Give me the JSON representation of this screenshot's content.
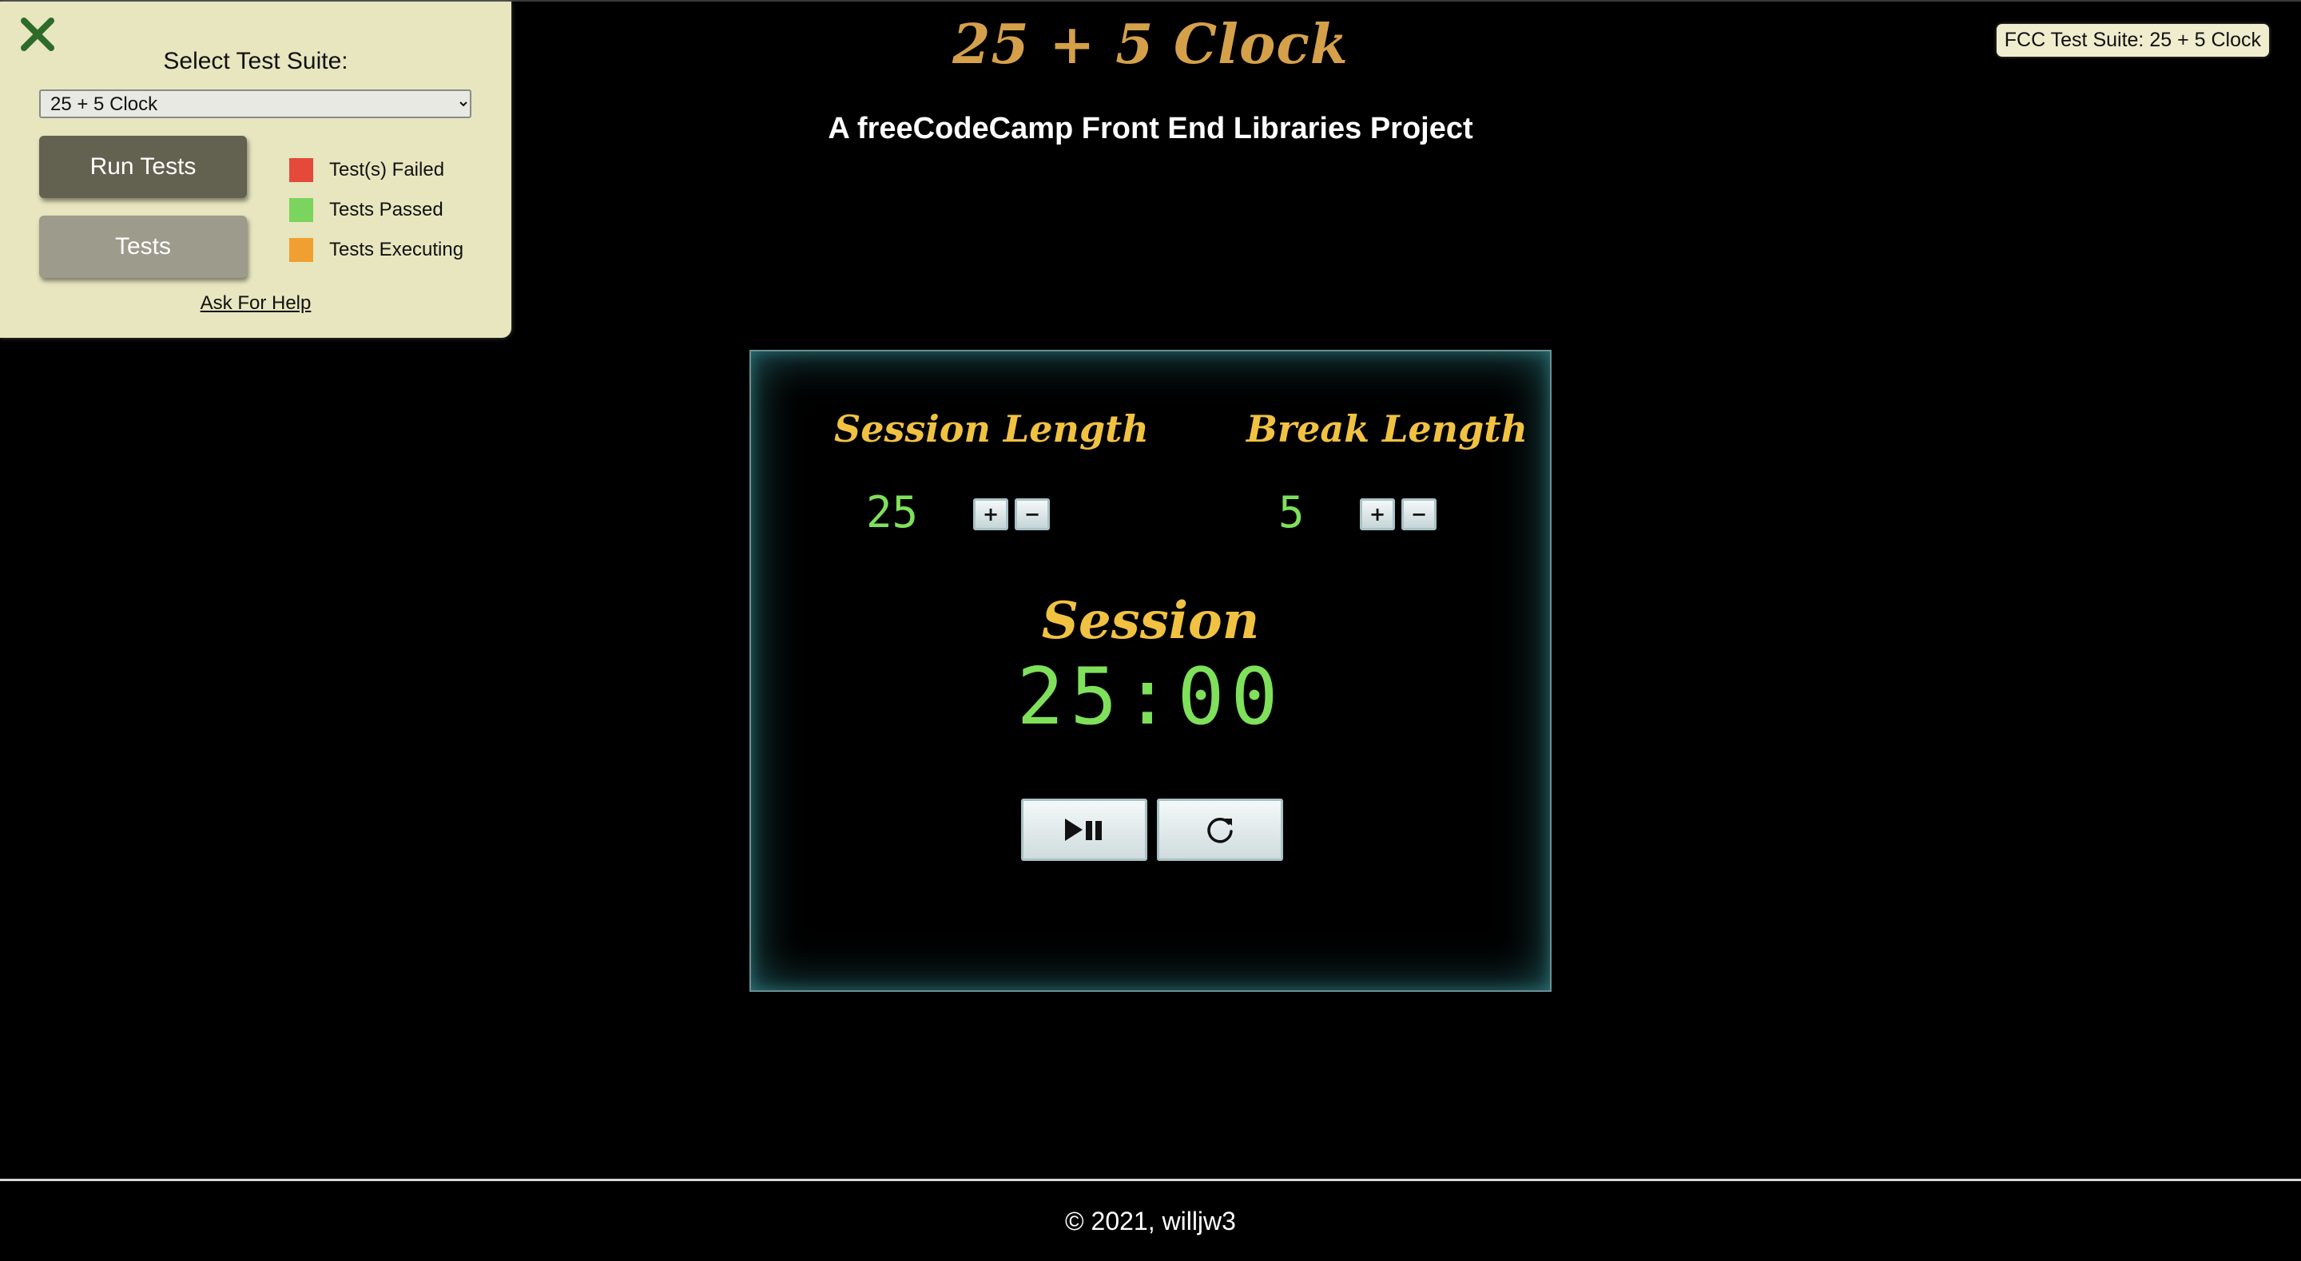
{
  "header": {
    "title": "25 + 5 Clock",
    "subtitle": "A freeCodeCamp Front End Libraries Project"
  },
  "fcc_badge": {
    "label": "FCC Test Suite: 25 + 5 Clock"
  },
  "test_panel": {
    "close_icon": "close-x-icon",
    "heading": "Select Test Suite:",
    "suite_select": {
      "selected": "25 + 5 Clock",
      "options": [
        "25 + 5 Clock"
      ]
    },
    "run_tests_label": "Run Tests",
    "tests_label": "Tests",
    "legend": [
      {
        "label": "Test(s) Failed",
        "color": "#e5493a"
      },
      {
        "label": "Tests Passed",
        "color": "#7bd45e"
      },
      {
        "label": "Tests Executing",
        "color": "#f0a030"
      }
    ],
    "help_link": "Ask For Help",
    "colors": {
      "panel_bg": "#e7e6bf",
      "close_icon": "#2e6b2a",
      "run_tests_bg": "#63614f",
      "tests_bg": "#9c9b8c"
    }
  },
  "clock": {
    "session_label": "Session Length",
    "break_label": "Break Length",
    "session_length": "25",
    "break_length": "5",
    "increment_symbol": "+",
    "decrement_symbol": "−",
    "timer_label": "Session",
    "time_left": "25:00",
    "start_stop_icon": "play-pause-icon",
    "reset_icon": "refresh-icon",
    "colors": {
      "title": "#f1c242",
      "digits": "#7fe05b",
      "glow": "#40aab0"
    }
  },
  "footer": {
    "text": "© 2021, willjw3"
  }
}
